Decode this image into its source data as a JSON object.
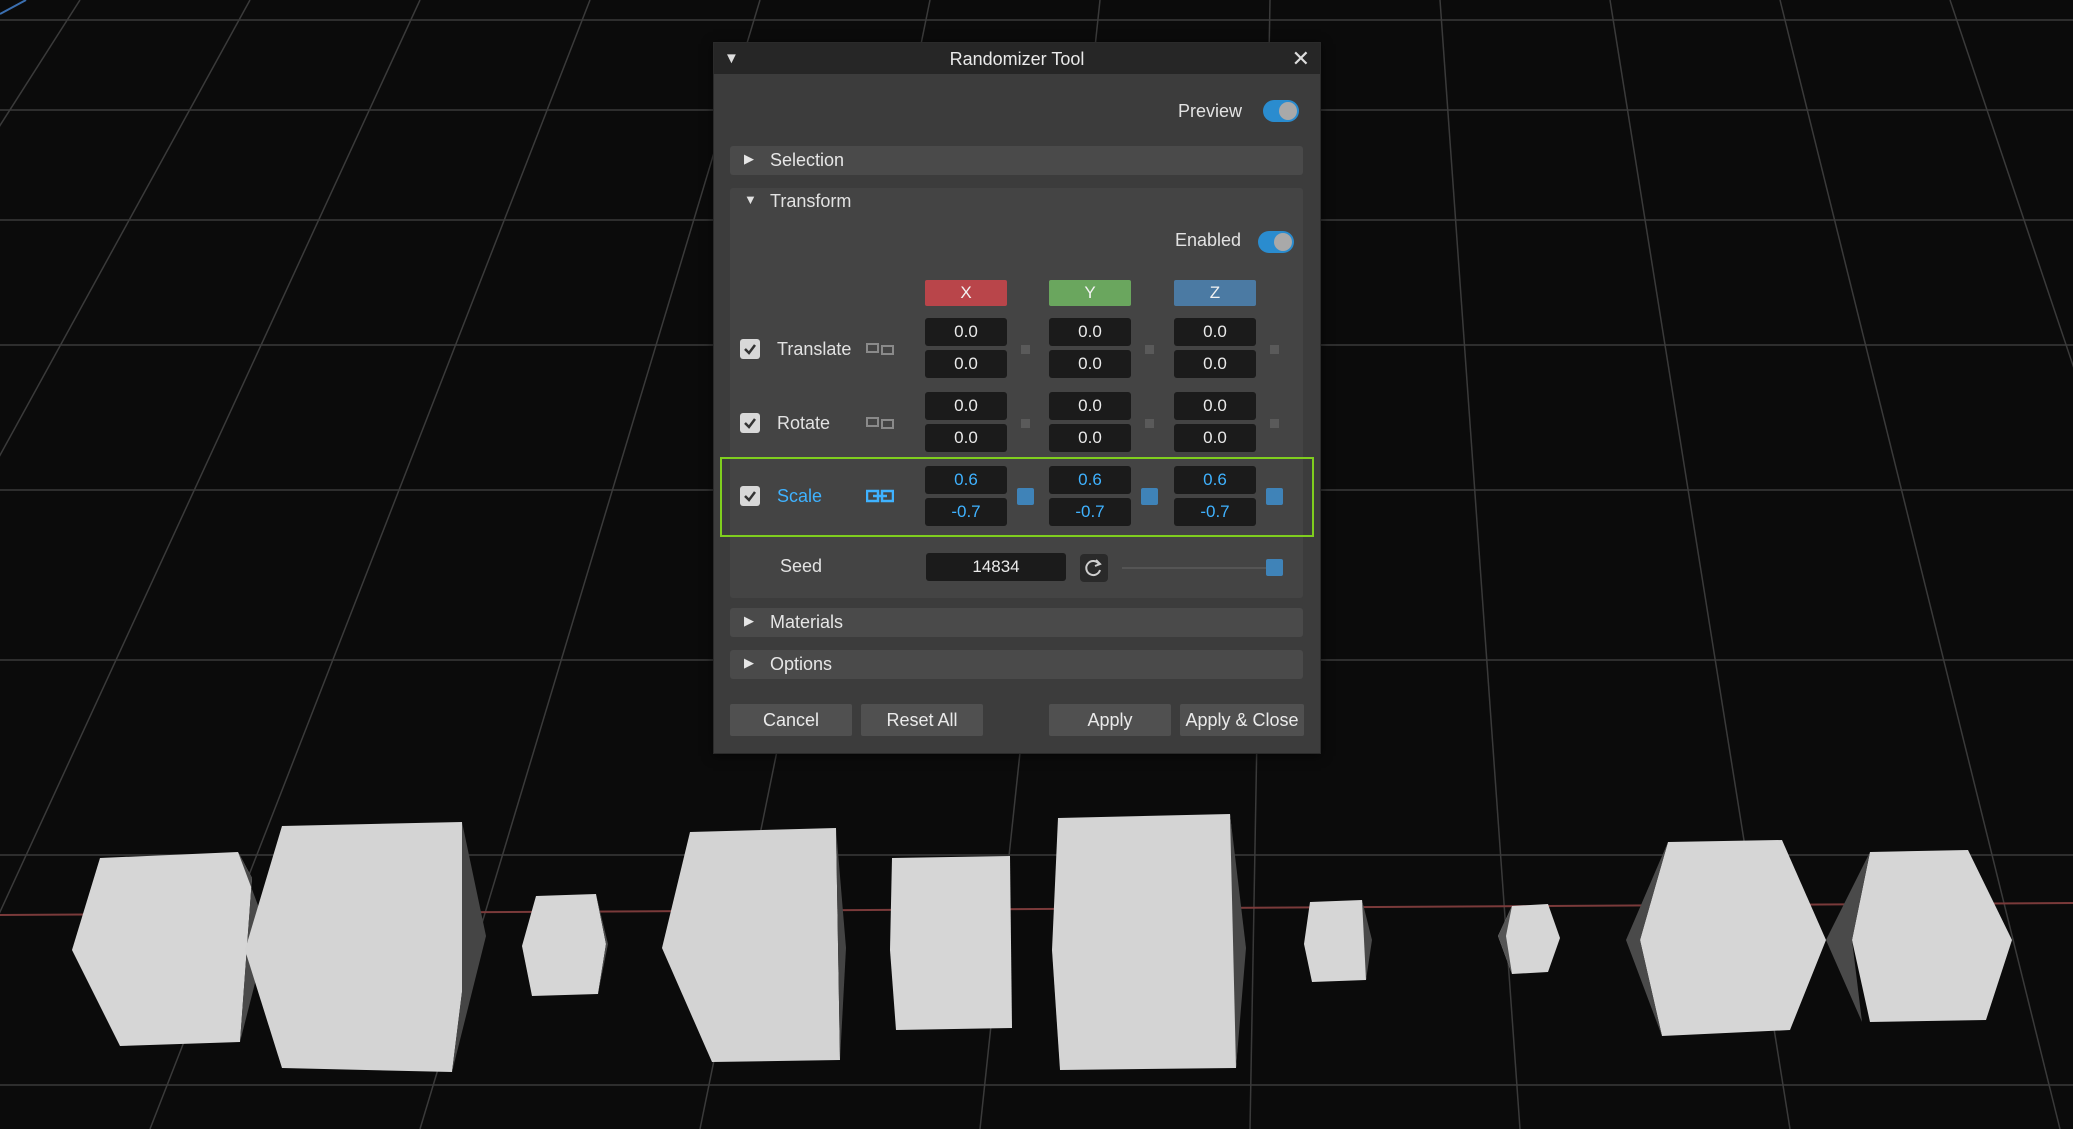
{
  "dialog": {
    "title": "Randomizer Tool",
    "close_glyph": "✕",
    "collapse_glyph": "▼"
  },
  "preview": {
    "label": "Preview",
    "on": true
  },
  "sections": {
    "selection": {
      "label": "Selection",
      "expanded": false
    },
    "transform": {
      "label": "Transform",
      "expanded": true
    },
    "materials": {
      "label": "Materials",
      "expanded": false
    },
    "options": {
      "label": "Options",
      "expanded": false
    }
  },
  "transform": {
    "enabled_label": "Enabled",
    "enabled": true,
    "axes": {
      "x": "X",
      "y": "Y",
      "z": "Z"
    },
    "rows": [
      {
        "label": "Translate",
        "checked": true,
        "linked": false,
        "x": [
          "0.0",
          "0.0"
        ],
        "y": [
          "0.0",
          "0.0"
        ],
        "z": [
          "0.0",
          "0.0"
        ]
      },
      {
        "label": "Rotate",
        "checked": true,
        "linked": false,
        "x": [
          "0.0",
          "0.0"
        ],
        "y": [
          "0.0",
          "0.0"
        ],
        "z": [
          "0.0",
          "0.0"
        ]
      },
      {
        "label": "Scale",
        "checked": true,
        "linked": true,
        "x": [
          "0.6",
          "-0.7"
        ],
        "y": [
          "0.6",
          "-0.7"
        ],
        "z": [
          "0.6",
          "-0.7"
        ]
      }
    ],
    "seed_label": "Seed",
    "seed_value": "14834"
  },
  "buttons": {
    "cancel": "Cancel",
    "reset_all": "Reset All",
    "apply": "Apply",
    "apply_close": "Apply & Close"
  },
  "colors": {
    "accent": "#3fb2ff",
    "axis_x": "#b9454a",
    "axis_y": "#6aa65e",
    "axis_z": "#4b7aa3",
    "highlight": "#7fce1e",
    "toggle": "#2a8ccf"
  }
}
